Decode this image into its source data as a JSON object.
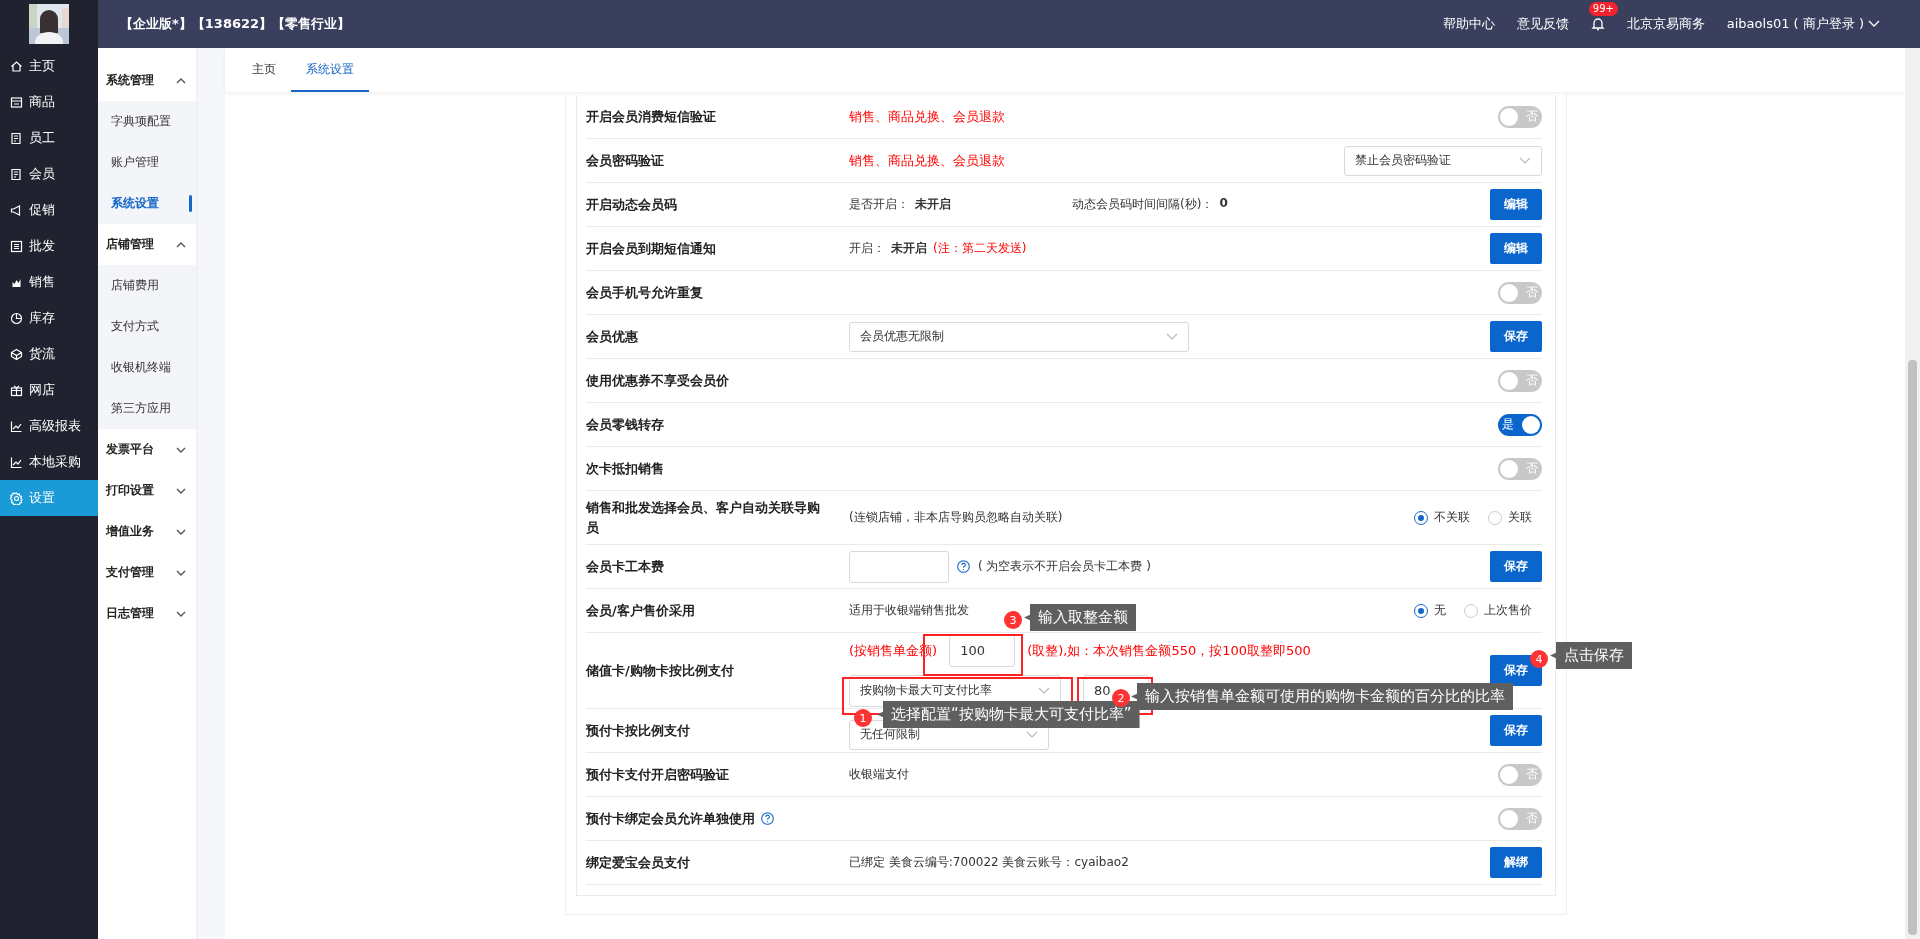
{
  "top_bar": {
    "title": "【企业版*】【138622】【零售行业】",
    "links": [
      "帮助中心",
      "意见反馈"
    ],
    "notification_badge": "99+",
    "company": "北京京易商务",
    "user": "aibaols01 ( 商户登录 )"
  },
  "main_nav": [
    {
      "label": "主页",
      "selected": false
    },
    {
      "label": "商品",
      "selected": false
    },
    {
      "label": "员工",
      "selected": false
    },
    {
      "label": "会员",
      "selected": false
    },
    {
      "label": "促销",
      "selected": false
    },
    {
      "label": "批发",
      "selected": false
    },
    {
      "label": "销售",
      "selected": false
    },
    {
      "label": "库存",
      "selected": false
    },
    {
      "label": "货流",
      "selected": false
    },
    {
      "label": "网店",
      "selected": false
    },
    {
      "label": "高级报表",
      "selected": false
    },
    {
      "label": "本地采购",
      "selected": false
    },
    {
      "label": "设置",
      "selected": true
    }
  ],
  "settings_nav": [
    {
      "label": "系统管理",
      "expanded": true,
      "children": [
        {
          "label": "字典项配置",
          "selected": false
        },
        {
          "label": "账户管理",
          "selected": false
        },
        {
          "label": "系统设置",
          "selected": true
        }
      ]
    },
    {
      "label": "店铺管理",
      "expanded": true,
      "children": [
        {
          "label": "店铺费用",
          "selected": false
        },
        {
          "label": "支付方式",
          "selected": false
        },
        {
          "label": "收银机终端",
          "selected": false
        },
        {
          "label": "第三方应用",
          "selected": false
        }
      ]
    },
    {
      "label": "发票平台",
      "expanded": false
    },
    {
      "label": "打印设置",
      "expanded": false
    },
    {
      "label": "增值业务",
      "expanded": false
    },
    {
      "label": "支付管理",
      "expanded": false
    },
    {
      "label": "日志管理",
      "expanded": false
    }
  ],
  "tabs": [
    {
      "label": "主页",
      "selected": false
    },
    {
      "label": "系统设置",
      "selected": true
    }
  ],
  "settings": [
    {
      "kind": "toggle",
      "label": "开启会员消费短信验证",
      "scopes": "销售、商品兑换、会员退款",
      "on": false,
      "toggle_text": "否"
    },
    {
      "kind": "select",
      "label": "会员密码验证",
      "scopes": "销售、商品兑换、会员退款",
      "value": "禁止会员密码验证"
    },
    {
      "kind": "status",
      "label": "开启动态会员码",
      "fields": [
        {
          "label": "是否开启：",
          "value": "未开启"
        },
        {
          "label": "动态会员码时间间隔(秒)：",
          "value": "0"
        }
      ],
      "button": "编辑"
    },
    {
      "kind": "status",
      "label": "开启会员到期短信通知",
      "fields": [
        {
          "label": "开启：",
          "value": "未开启",
          "warning": "(注：第二天发送)"
        }
      ],
      "button": "编辑"
    },
    {
      "kind": "toggle",
      "label": "会员手机号允许重复",
      "on": false,
      "toggle_text": "否"
    },
    {
      "kind": "select_save",
      "label": "会员优惠",
      "value": "会员优惠无限制",
      "button": "保存"
    },
    {
      "kind": "toggle",
      "label": "使用优惠券不享受会员价",
      "on": false,
      "toggle_text": "否"
    },
    {
      "kind": "toggle",
      "label": "会员零钱转存",
      "on": true,
      "toggle_text": "是"
    },
    {
      "kind": "toggle",
      "label": "次卡抵扣销售",
      "on": false,
      "toggle_text": "否"
    },
    {
      "kind": "radio",
      "label": "销售和批发选择会员、客户自动关联导购员",
      "hint": "(连锁店铺，非本店导购员忽略自动关联)",
      "options": [
        {
          "label": "不关联",
          "selected": true
        },
        {
          "label": "关联",
          "selected": false
        }
      ]
    },
    {
      "kind": "input_save",
      "label": "会员卡工本费",
      "help": true,
      "hint": "( 为空表示不开启会员卡工本费 )",
      "button": "保存"
    },
    {
      "kind": "radio",
      "label": "会员/客户售价采用",
      "hint": "适用于收银端销售批发",
      "options": [
        {
          "label": "无",
          "selected": true
        },
        {
          "label": "上次售价",
          "selected": false
        }
      ]
    },
    {
      "kind": "ratio",
      "label": "储值卡/购物卡按比例支付",
      "prefix": "(按销售单金额)",
      "amount": "100",
      "suffix": "(取整),如：本次销售金额550，按100取整即500",
      "mode": "按购物卡最大可支付比率",
      "ratio": "80",
      "button": "保存"
    },
    {
      "kind": "select_save",
      "label": "预付卡按比例支付",
      "value": "无任何限制",
      "button": "保存"
    },
    {
      "kind": "toggle",
      "label": "预付卡支付开启密码验证",
      "hint": "收银端支付",
      "on": false,
      "toggle_text": "否"
    },
    {
      "kind": "toggle",
      "label": "预付卡绑定会员允许单独使用",
      "help": true,
      "on": false,
      "toggle_text": "否"
    },
    {
      "kind": "button",
      "label": "绑定爱宝会员支付",
      "hint": "已绑定 美食云编号:700022 美食云账号：cyaibao2",
      "button": "解绑"
    }
  ],
  "annotations": [
    {
      "step": "1",
      "text": "选择配置“按购物卡最大可支付比率”",
      "framed": true
    },
    {
      "step": "2",
      "text": "输入按销售单金额可使用的购物卡金额的百分比的比率",
      "framed": true
    },
    {
      "step": "3",
      "text": "输入取整金额",
      "framed": true
    },
    {
      "step": "4",
      "text": "点击保存",
      "framed": false
    }
  ]
}
